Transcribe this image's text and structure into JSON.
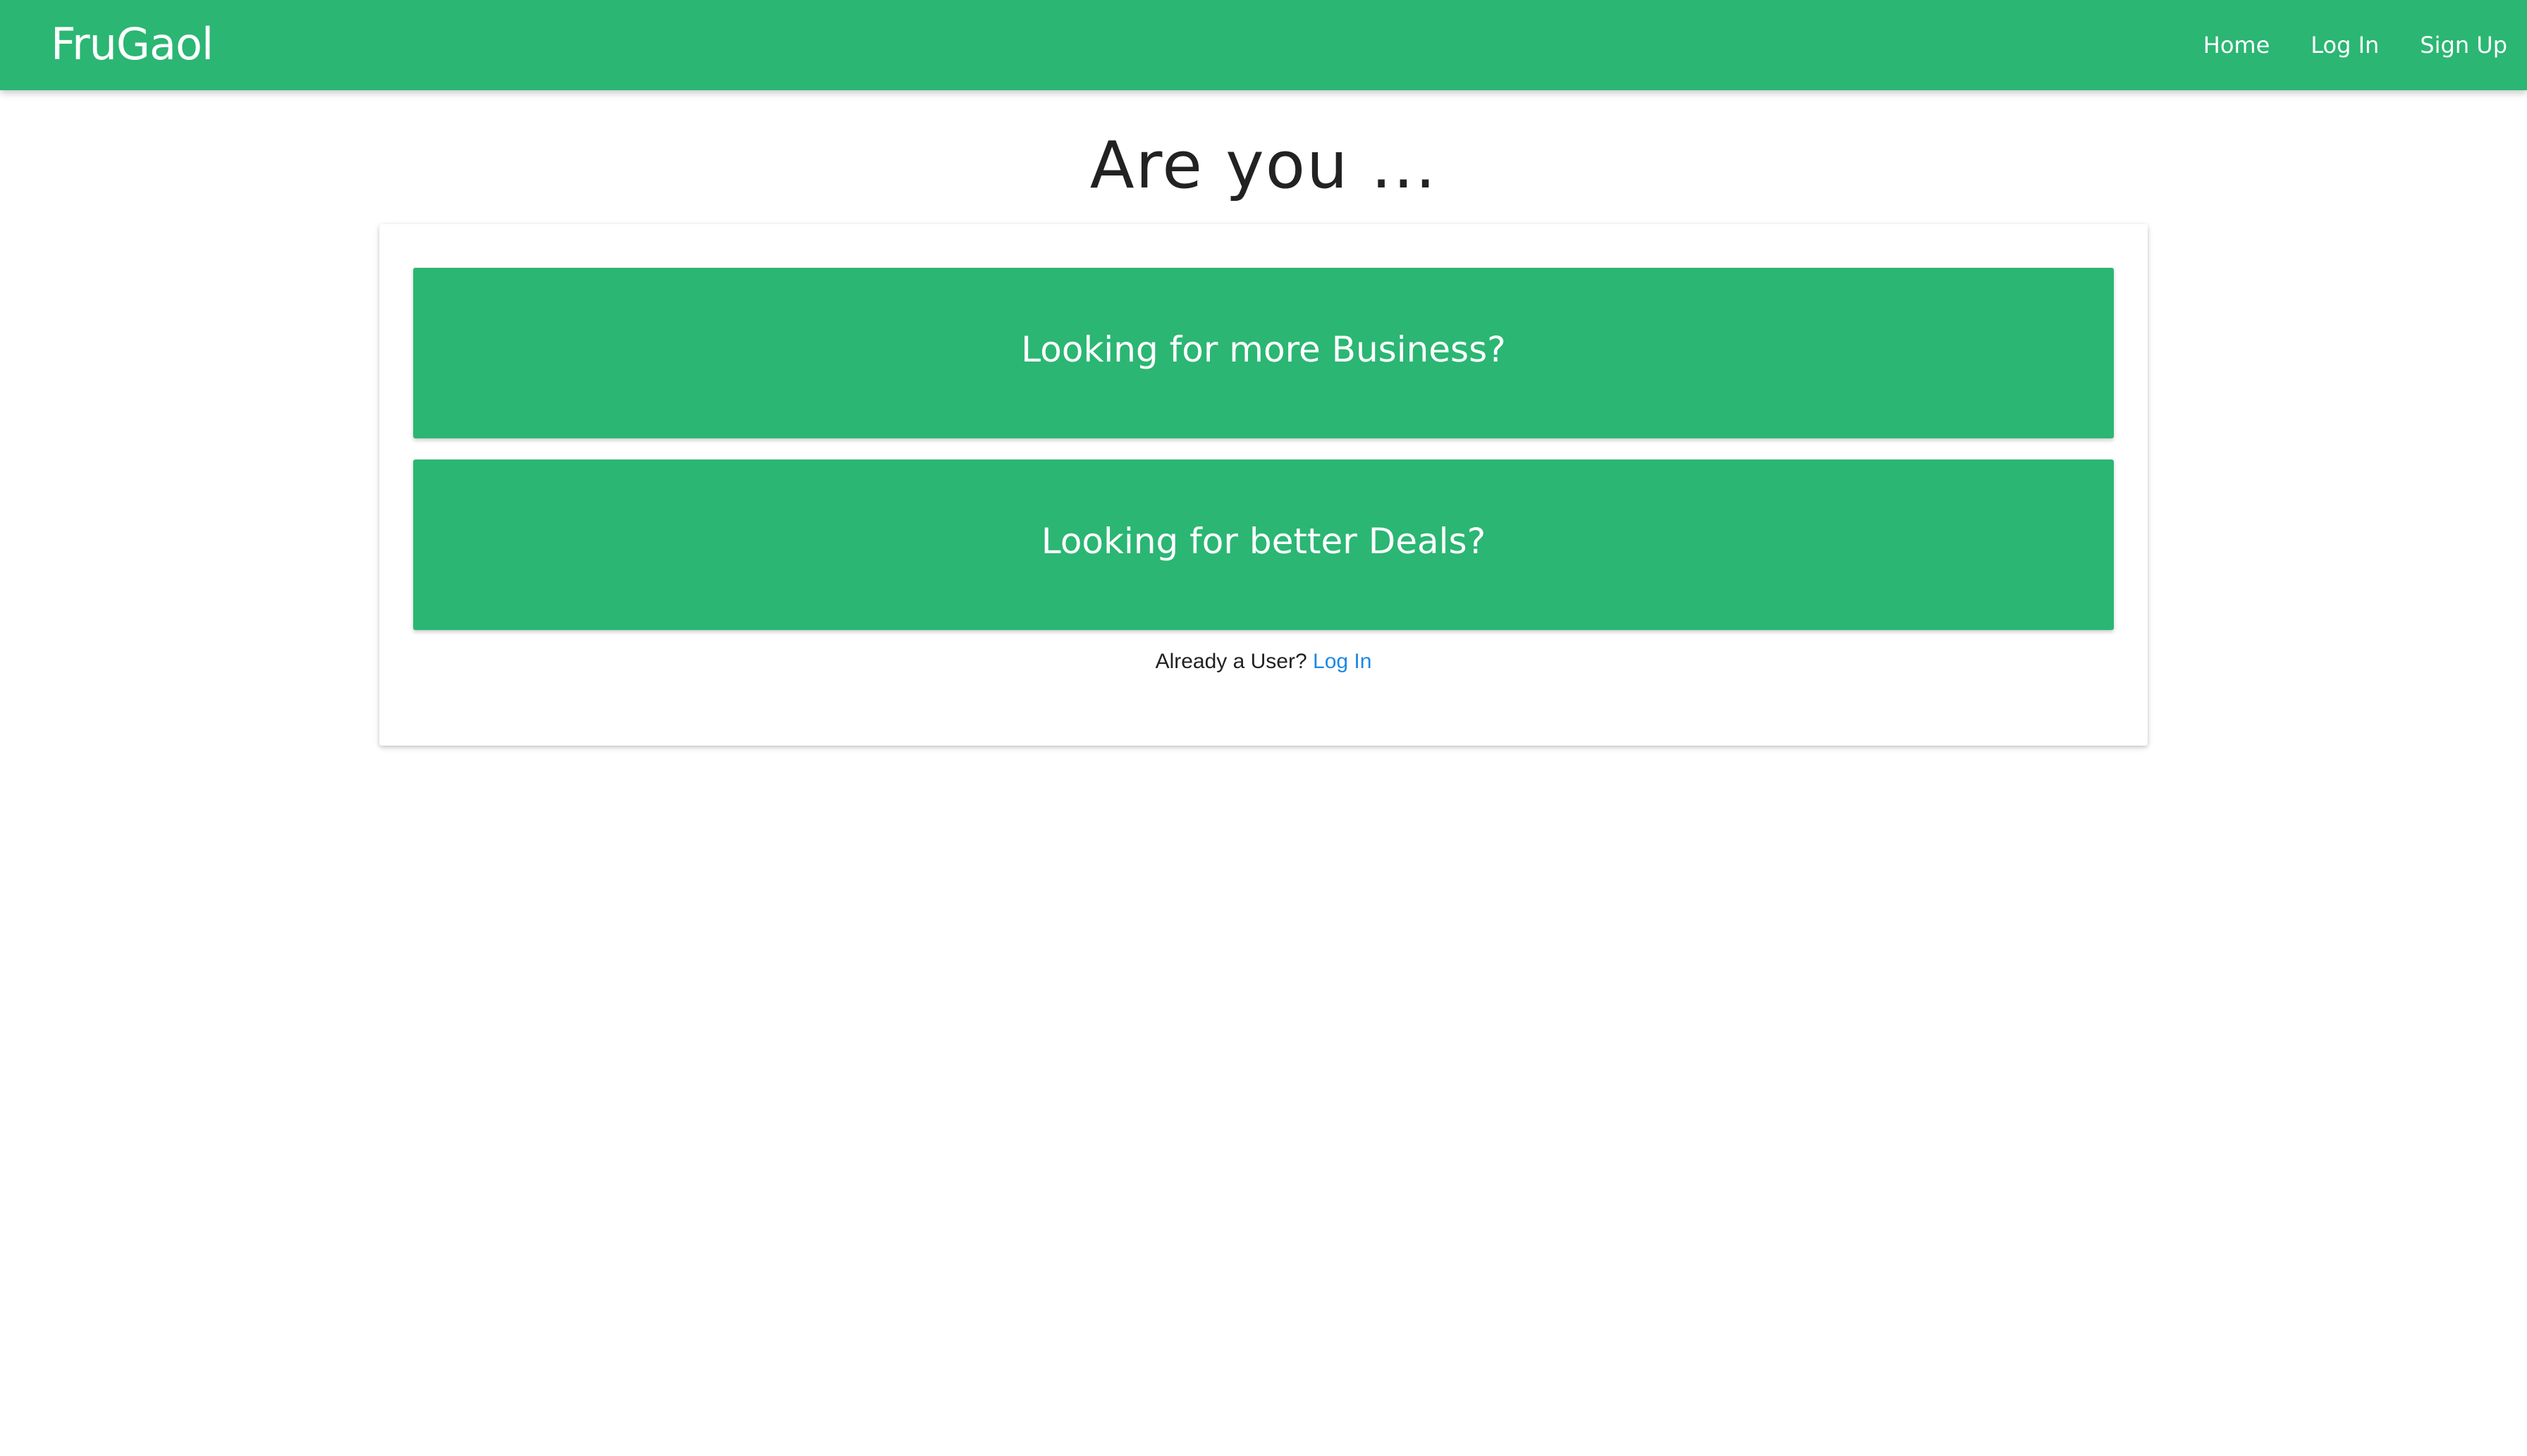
{
  "navbar": {
    "brand": "FruGaol",
    "links": [
      "Home",
      "Log In",
      "Sign Up"
    ]
  },
  "main": {
    "title": "Are you ...",
    "choices": [
      "Looking for more Business?",
      "Looking for better Deals?"
    ],
    "already_user_text": "Already a User?",
    "login_link": "Log In"
  },
  "colors": {
    "primary": "#2bb673",
    "link": "#1e88e5",
    "text": "#222222",
    "background": "#ffffff"
  }
}
